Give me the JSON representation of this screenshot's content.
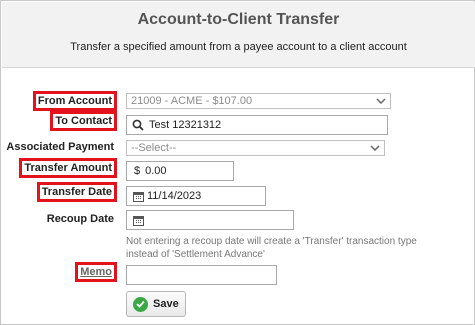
{
  "dialog": {
    "title": "Account-to-Client Transfer",
    "subtitle": "Transfer a specified amount from a payee account to a client account"
  },
  "form": {
    "from_account": {
      "label": "From Account",
      "value": "21009 - ACME - $107.00"
    },
    "to_contact": {
      "label": "To Contact",
      "value": "Test 12321312"
    },
    "associated_payment": {
      "label": "Associated Payment",
      "value": "--Select--"
    },
    "transfer_amount": {
      "label": "Transfer Amount",
      "currency": "$",
      "value": "0.00"
    },
    "transfer_date": {
      "label": "Transfer Date",
      "value": "11/14/2023"
    },
    "recoup_date": {
      "label": "Recoup Date",
      "value": "",
      "note_line1": "Not entering a recoup date will create a 'Transfer' transaction type",
      "note_line2": "instead of 'Settlement Advance'"
    },
    "memo": {
      "label": "Memo",
      "value": ""
    }
  },
  "actions": {
    "save_label": "Save"
  },
  "colors": {
    "highlight": "#e3121c",
    "save_icon": "#3aa845",
    "header_bg": "#f2f2f2"
  },
  "icons": {
    "chevron": "chevron-down-icon",
    "search": "search-icon",
    "calendar": "calendar-icon",
    "save": "check-circle-icon"
  }
}
